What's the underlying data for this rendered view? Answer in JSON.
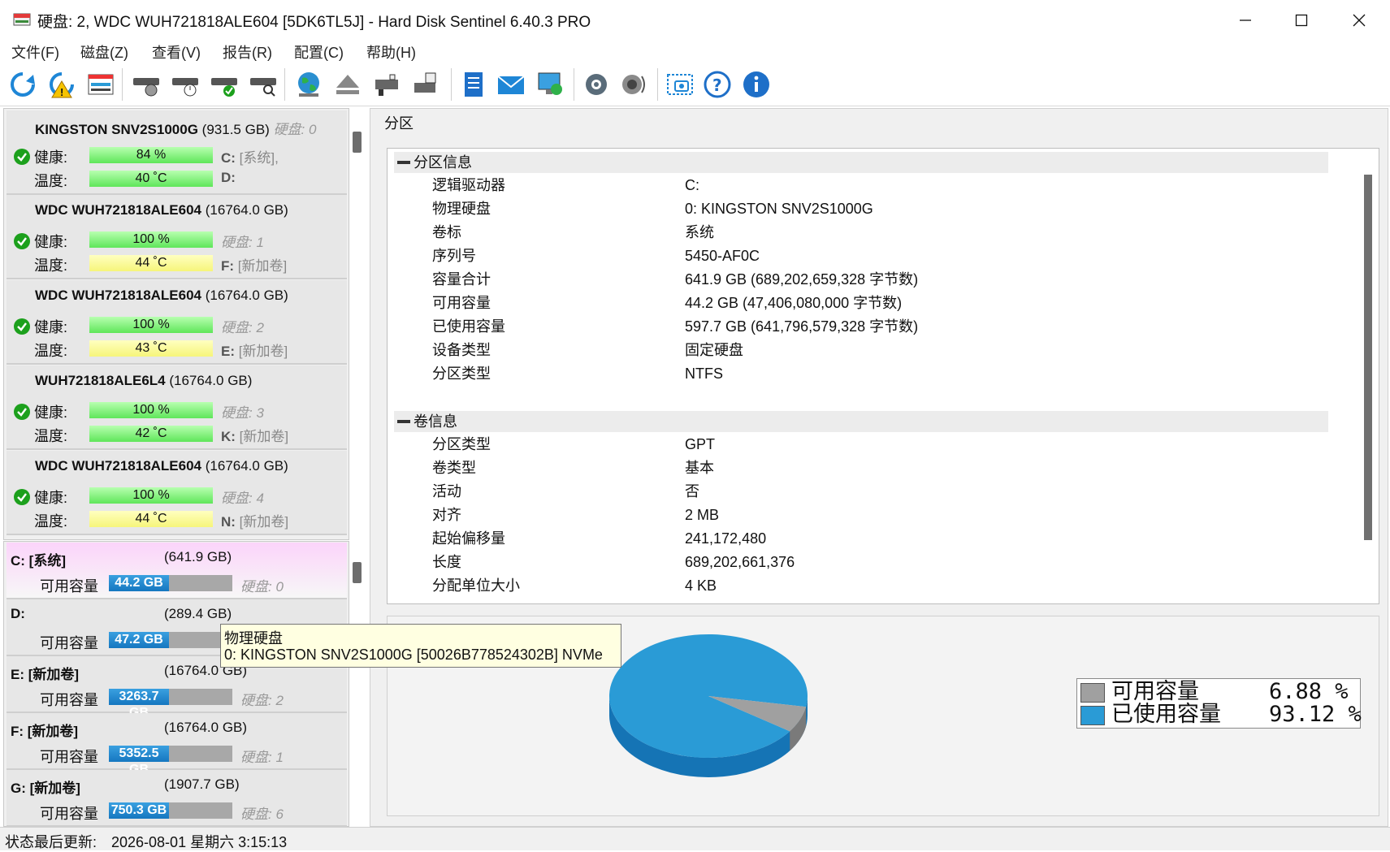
{
  "window": {
    "title": "硬盘:   2, WDC  WUH721818ALE604 [5DK6TL5J]  -  Hard Disk Sentinel 6.40.3 PRO"
  },
  "menu": [
    "文件(F)",
    "磁盘(Z)",
    "查看(V)",
    "报告(R)",
    "配置(C)",
    "帮助(H)"
  ],
  "toolbar": {
    "icons": [
      "refresh-icon",
      "refresh-warning-icon",
      "disk-info-icon",
      "disk-surface-icon",
      "disk-timer-icon",
      "disk-ok-icon",
      "disk-search-icon",
      "globe-icon",
      "eject-icon",
      "drive-cable-icon",
      "drive-usb-icon",
      "report-icon",
      "mail-icon",
      "network-monitor-icon",
      "gear-icon",
      "speaker-icon",
      "screenshot-icon",
      "help-icon",
      "info-icon"
    ]
  },
  "disks": [
    {
      "name": "KINGSTON SNV2S1000G",
      "size": "(931.5 GB)",
      "disk_label": "硬盘:  0",
      "health_label": "健康:",
      "health": "84 %",
      "health_value": 84,
      "temp_label": "温度:",
      "temp": "40 ˚C",
      "temp_color": "green",
      "drive1": "C:",
      "drive1_rest": " [系统],",
      "drive2": "D:",
      "drive2_rest": ""
    },
    {
      "name": "WDC  WUH721818ALE604",
      "size": "(16764.0 GB)",
      "disk_label": "硬盘:  1",
      "health_label": "健康:",
      "health": "100 %",
      "health_value": 100,
      "temp_label": "温度:",
      "temp": "44 ˚C",
      "temp_color": "yellow",
      "drive2": "F:",
      "drive2_rest": " [新加卷]"
    },
    {
      "name": "WDC  WUH721818ALE604",
      "size": "(16764.0 GB)",
      "disk_label": "硬盘:  2",
      "health_label": "健康:",
      "health": "100 %",
      "health_value": 100,
      "temp_label": "温度:",
      "temp": "43 ˚C",
      "temp_color": "yellow",
      "drive2": "E:",
      "drive2_rest": " [新加卷]"
    },
    {
      "name": "WUH721818ALE6L4",
      "size": "(16764.0 GB)",
      "disk_label": "硬盘:  3",
      "health_label": "健康:",
      "health": "100 %",
      "health_value": 100,
      "temp_label": "温度:",
      "temp": "42 ˚C",
      "temp_color": "green",
      "drive2": "K:",
      "drive2_rest": " [新加卷]"
    },
    {
      "name": "WDC  WUH721818ALE604",
      "size": "(16764.0 GB)",
      "disk_label": "硬盘:  4",
      "health_label": "健康:",
      "health": "100 %",
      "health_value": 100,
      "temp_label": "温度:",
      "temp": "44 ˚C",
      "temp_color": "yellow",
      "drive2": "N:",
      "drive2_rest": " [新加卷]"
    }
  ],
  "partitions": [
    {
      "name": "C: [系统]",
      "size": "(641.9 GB)",
      "free_label": "可用容量",
      "free": "44.2 GB",
      "disk": "硬盘:  0",
      "selected": true
    },
    {
      "name": "D:",
      "size": "(289.4 GB)",
      "free_label": "可用容量",
      "free": "47.2 GB",
      "disk": "",
      "selected": false
    },
    {
      "name": "E: [新加卷]",
      "size": "(16764.0 GB)",
      "free_label": "可用容量",
      "free": "3263.7 GB",
      "disk": "硬盘:  2",
      "selected": false
    },
    {
      "name": "F: [新加卷]",
      "size": "(16764.0 GB)",
      "free_label": "可用容量",
      "free": "5352.5 GB",
      "disk": "硬盘:  1",
      "selected": false
    },
    {
      "name": "G: [新加卷]",
      "size": "(1907.7 GB)",
      "free_label": "可用容量",
      "free": "750.3 GB",
      "disk": "硬盘:  6",
      "selected": false
    }
  ],
  "tab": "分区",
  "partition_info": {
    "header": "分区信息",
    "rows": [
      {
        "k": "逻辑驱动器",
        "v": "C:"
      },
      {
        "k": "物理硬盘",
        "v": "0: KINGSTON SNV2S1000G"
      },
      {
        "k": "卷标",
        "v": "系统"
      },
      {
        "k": "序列号",
        "v": "5450-AF0C"
      },
      {
        "k": "容量合计",
        "v": "641.9 GB (689,202,659,328 字节数)"
      },
      {
        "k": "可用容量",
        "v": "44.2 GB (47,406,080,000 字节数)"
      },
      {
        "k": "已使用容量",
        "v": "597.7 GB (641,796,579,328 字节数)"
      },
      {
        "k": "设备类型",
        "v": "固定硬盘"
      },
      {
        "k": "分区类型",
        "v": "NTFS"
      }
    ]
  },
  "volume_info": {
    "header": "卷信息",
    "rows": [
      {
        "k": "分区类型",
        "v": "GPT"
      },
      {
        "k": "卷类型",
        "v": "基本"
      },
      {
        "k": "活动",
        "v": "否"
      },
      {
        "k": "对齐",
        "v": "2 MB"
      },
      {
        "k": "起始偏移量",
        "v": "241,172,480"
      },
      {
        "k": "长度",
        "v": "689,202,661,376"
      },
      {
        "k": "分配单位大小",
        "v": "4 KB"
      }
    ]
  },
  "chart_data": {
    "type": "pie",
    "title": "",
    "categories": [
      "可用容量",
      "已使用容量"
    ],
    "values": [
      6.88,
      93.12
    ],
    "labels": [
      "6.88 %",
      "93.12 %"
    ],
    "colors": [
      "#a0a0a0",
      "#2a9bd6"
    ],
    "legend_position": "right"
  },
  "tooltip": {
    "line1": "物理硬盘",
    "line2": "0: KINGSTON SNV2S1000G [50026B778524302B] NVMe"
  },
  "status": {
    "label": "状态最后更新:",
    "value": "2026-08-01 星期六 3:15:13"
  },
  "colors": {
    "health_green": "#5fe65a",
    "temp_yellow": "#f6f57a",
    "free_blue": "#1577c0",
    "selected_pink": "#fbd4fa"
  }
}
